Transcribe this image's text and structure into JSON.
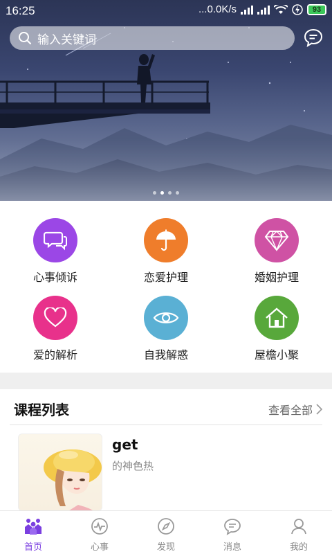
{
  "status_bar": {
    "time": "16:25",
    "network_speed": "...0.0K/s",
    "battery": "93"
  },
  "search": {
    "placeholder": "输入关键词",
    "icon": "search-icon"
  },
  "banner": {
    "slides": 4,
    "active_slide": 1
  },
  "categories": [
    {
      "label": "心事倾诉",
      "icon": "chat-bubbles-icon",
      "color": "#9b47e6"
    },
    {
      "label": "恋爱护理",
      "icon": "umbrella-icon",
      "color": "#ef7d2b"
    },
    {
      "label": "婚姻护理",
      "icon": "diamond-icon",
      "color": "#cf52a4"
    },
    {
      "label": "爱的解析",
      "icon": "heart-icon",
      "color": "#e8318b"
    },
    {
      "label": "自我解惑",
      "icon": "eye-icon",
      "color": "#5ab0d4"
    },
    {
      "label": "屋檐小聚",
      "icon": "house-icon",
      "color": "#58a83b"
    }
  ],
  "course_section": {
    "title": "课程列表",
    "view_all": "查看全部",
    "items": [
      {
        "title": "get",
        "subtitle": "的神色热"
      }
    ]
  },
  "tabbar": {
    "accent": "#7b3fe0",
    "items": [
      {
        "label": "首页",
        "icon": "home-people-icon",
        "active": true
      },
      {
        "label": "心事",
        "icon": "heart-pulse-icon",
        "active": false
      },
      {
        "label": "发现",
        "icon": "compass-icon",
        "active": false
      },
      {
        "label": "消息",
        "icon": "message-icon",
        "active": false
      },
      {
        "label": "我的",
        "icon": "user-icon",
        "active": false
      }
    ]
  }
}
